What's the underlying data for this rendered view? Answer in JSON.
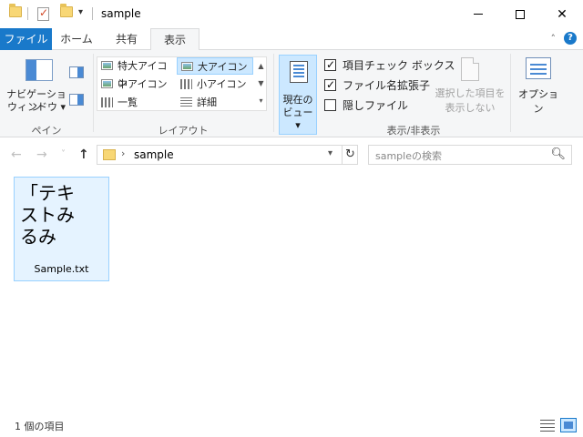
{
  "window": {
    "title": "sample",
    "minimize": "",
    "close_glyph": "✕"
  },
  "quick_access": {
    "dropdown_glyph": "▾"
  },
  "ribbon_tabs": [
    {
      "label": "ファイル"
    },
    {
      "label": "ホーム"
    },
    {
      "label": "共有"
    },
    {
      "label": "表示"
    }
  ],
  "ribbon": {
    "collapse_glyph": "˄",
    "help_glyph": "?",
    "panes": {
      "nav_pane_label_line1": "ナビゲーション",
      "nav_pane_label_line2": "ウィンドウ ▾",
      "group_label": "ペイン"
    },
    "layout": {
      "items": [
        "特大アイコン",
        "大アイコン",
        "中アイコン",
        "小アイコン",
        "一覧",
        "詳細"
      ],
      "group_label": "レイアウト",
      "selected": "大アイコン"
    },
    "current_view": {
      "label_line1": "現在の",
      "label_line2": "ビュー ▾"
    },
    "show_hide": {
      "item_checkboxes": {
        "label": "項目チェック ボックス",
        "checked": true
      },
      "file_extensions": {
        "label": "ファイル名拡張子",
        "checked": true
      },
      "hidden_files": {
        "label": "隠しファイル",
        "checked": false
      },
      "hide_selected_line1": "選択した項目を",
      "hide_selected_line2": "表示しない",
      "group_label": "表示/非表示"
    },
    "options": {
      "label": "オプション"
    }
  },
  "navigation": {
    "back_glyph": "←",
    "forward_glyph": "→",
    "recent_glyph": "˅",
    "up_glyph": "↑",
    "breadcrumb_chevron": "›",
    "path": "sample",
    "refresh_glyph": "↻",
    "search_placeholder": "sampleの検索",
    "search_glyph": "⚲"
  },
  "files": [
    {
      "name": "Sample.txt",
      "preview": "「テキ\nストみ\nるみ"
    }
  ],
  "status": {
    "item_count": "1 個の項目"
  },
  "colors": {
    "accent": "#1979ca",
    "selection": "#cce8ff",
    "selection_border": "#99d1ff"
  }
}
